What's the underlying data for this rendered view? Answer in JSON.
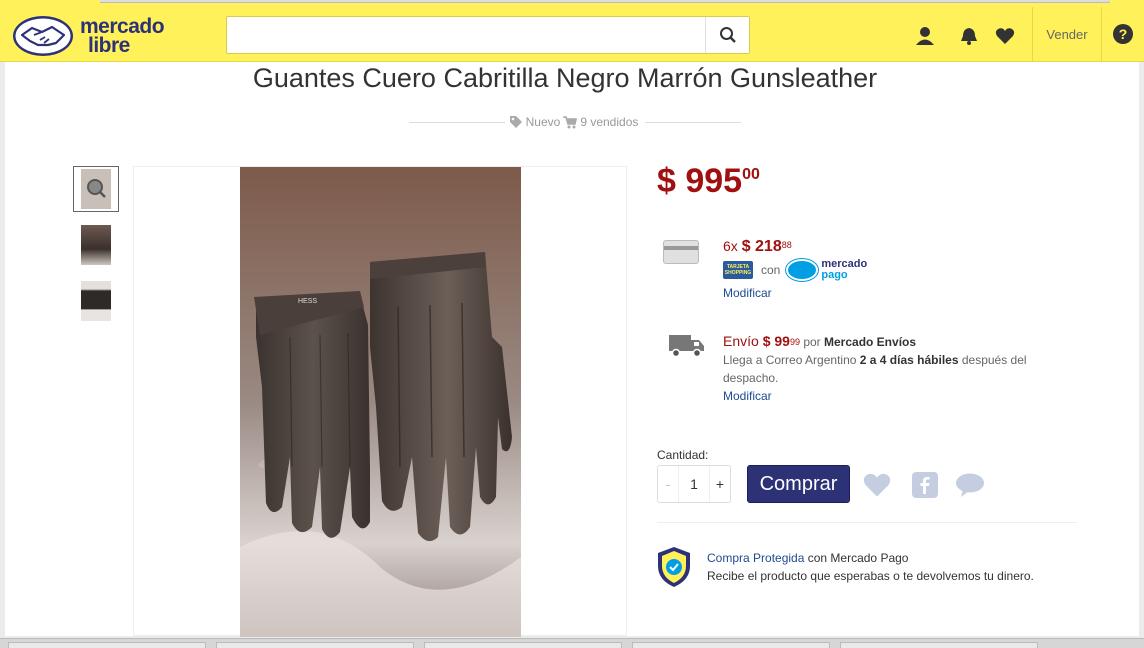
{
  "header": {
    "logo_line1": "mercado",
    "logo_line2": "libre",
    "search_placeholder": "",
    "vender_label": "Vender",
    "help_label": "?"
  },
  "product": {
    "title": "Guantes Cuero Cabritilla Negro Marrón Gunsleather",
    "condition": "Nuevo",
    "sold": "9 vendidos",
    "price_int": "$ 995",
    "price_cents": "00",
    "thumbnail_count": 3,
    "photo_tag": "HESS"
  },
  "payment": {
    "installments_prefix": "6x",
    "installment_int": "$ 218",
    "installment_cents": "88",
    "card_badge": "TARJETA SHOPPING",
    "con": "con",
    "mp_line1": "mercado",
    "mp_line2": "pago",
    "modify": "Modificar"
  },
  "shipping": {
    "label": "Envío",
    "price_int": "$ 99",
    "price_cents": "99",
    "by_prefix": "por",
    "by_name": "Mercado Envíos",
    "arrives_prefix": "Llega a Correo Argentino",
    "arrives_days": "2 a 4 días hábiles",
    "arrives_suffix": "después del despacho.",
    "modify": "Modificar"
  },
  "purchase": {
    "quantity_label": "Cantidad:",
    "minus": "-",
    "quantity": "1",
    "plus": "+",
    "buy_label": "Comprar"
  },
  "protection": {
    "link": "Compra Protegida",
    "link_suffix": "con Mercado Pago",
    "description": "Recibe el producto que esperabas o te devolvemos tu dinero."
  },
  "colors": {
    "brand_yellow": "#fff159",
    "brand_blue": "#2d3277",
    "price_red": "#a01010",
    "link_blue": "#1e4b90"
  },
  "icons": [
    "search-icon",
    "user-icon",
    "bell-icon",
    "heart-icon",
    "help-icon",
    "tag-icon",
    "cart-icon",
    "credit-card-icon",
    "truck-icon",
    "facebook-icon",
    "comment-icon",
    "shield-icon",
    "zoom-icon"
  ]
}
